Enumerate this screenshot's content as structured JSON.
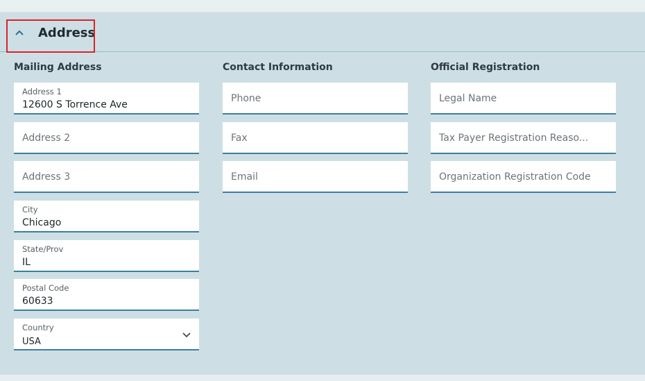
{
  "section": {
    "title": "Address"
  },
  "mailing": {
    "heading": "Mailing Address",
    "address1": {
      "label": "Address 1",
      "value": "12600 S Torrence Ave"
    },
    "address2": {
      "placeholder": "Address 2"
    },
    "address3": {
      "placeholder": "Address 3"
    },
    "city": {
      "label": "City",
      "value": "Chicago"
    },
    "state": {
      "label": "State/Prov",
      "value": "IL"
    },
    "postal": {
      "label": "Postal Code",
      "value": "60633"
    },
    "country": {
      "label": "Country",
      "value": "USA"
    }
  },
  "contact": {
    "heading": "Contact Information",
    "phone": {
      "placeholder": "Phone"
    },
    "fax": {
      "placeholder": "Fax"
    },
    "email": {
      "placeholder": "Email"
    }
  },
  "official": {
    "heading": "Official Registration",
    "legal_name": {
      "placeholder": "Legal Name"
    },
    "tax_payer": {
      "placeholder": "Tax Payer Registration Reaso..."
    },
    "org_code": {
      "placeholder": "Organization Registration Code"
    }
  },
  "colors": {
    "accent": "#3a7ea0",
    "panel": "#cddfe5",
    "highlight": "#d8232a"
  },
  "icons": {
    "toggle": "chevron-up-icon",
    "dropdown": "chevron-down-icon"
  }
}
